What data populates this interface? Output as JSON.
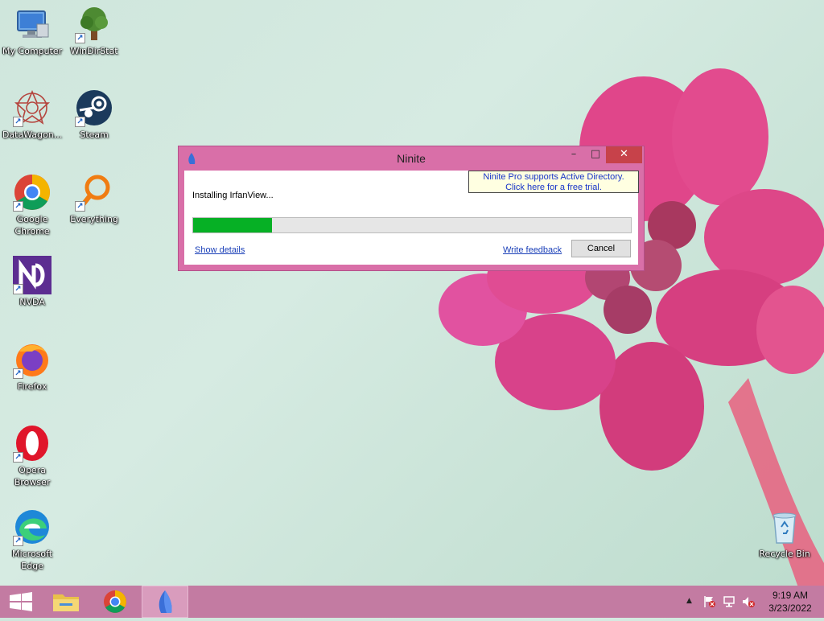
{
  "desktop": {
    "icons": [
      {
        "label": "My Computer",
        "icon": "computer-icon"
      },
      {
        "label": "WinDirStat",
        "icon": "windirstat-icon"
      },
      {
        "label": "DataWagon...",
        "icon": "datawagon-icon"
      },
      {
        "label": "Steam",
        "icon": "steam-icon"
      },
      {
        "label": "Google Chrome",
        "icon": "chrome-icon"
      },
      {
        "label": "Everything",
        "icon": "everything-icon"
      },
      {
        "label": "NVDA",
        "icon": "nvda-icon"
      },
      {
        "label": "Firefox",
        "icon": "firefox-icon"
      },
      {
        "label": "Opera Browser",
        "icon": "opera-icon"
      },
      {
        "label": "Microsoft Edge",
        "icon": "edge-icon"
      },
      {
        "label": "Recycle Bin",
        "icon": "recycle-bin-icon"
      }
    ]
  },
  "window": {
    "title": "Ninite",
    "minimize_glyph": "–",
    "maximize_glyph": "□",
    "close_glyph": "✕",
    "status": "Installing IrfanView...",
    "promo_line1": "Ninite Pro supports Active Directory.",
    "promo_line2": "Click here for a free trial.",
    "progress": 0.18,
    "show_details": "Show details",
    "write_feedback": "Write feedback",
    "cancel": "Cancel"
  },
  "taskbar": {
    "time": "9:19 AM",
    "date": "3/23/2022",
    "tray_up_glyph": "▲",
    "colors": {
      "bar": "#c37ba2",
      "active": "#d99cbd"
    }
  },
  "colors": {
    "window_frame": "#d96fa8",
    "progress_fill": "#06b025",
    "close_button": "#c7424a"
  }
}
